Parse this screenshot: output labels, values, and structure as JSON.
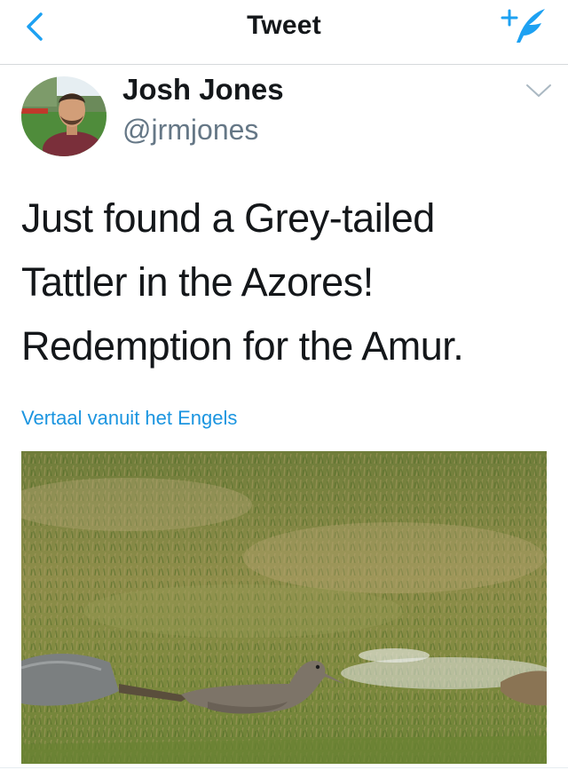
{
  "nav": {
    "title": "Tweet"
  },
  "user": {
    "name": "Josh Jones",
    "handle": "@jrmjones"
  },
  "tweet": {
    "lines": [
      "Just found a Grey-tailed",
      "Tattler in the Azores!",
      "Redemption for the Amur."
    ],
    "translate_label": "Vertaal vanuit het Engels"
  },
  "colors": {
    "accent": "#1da1f2",
    "link": "#1b95e0",
    "secondary_text": "#657786",
    "divider": "#d6d9dc"
  },
  "icons": {
    "back": "chevron-left-icon",
    "compose": "compose-quill-icon",
    "menu": "chevron-down-icon"
  }
}
